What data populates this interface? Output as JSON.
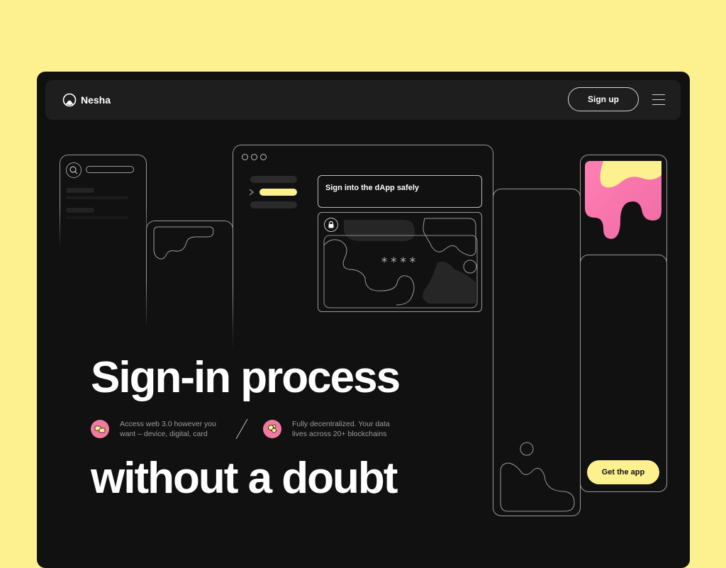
{
  "brand": {
    "name": "Nesha",
    "icon": "nesha-logo-icon"
  },
  "nav": {
    "signup_label": "Sign up",
    "menu_icon": "hamburger-menu-icon"
  },
  "illustration": {
    "card_title": "Sign into the dApp safely",
    "password_mask": "****",
    "lock_icon": "lock-icon",
    "arrow_icon": "chevron-right-icon"
  },
  "hero": {
    "headline_top": "Sign-in process",
    "headline_bottom": "without a doubt"
  },
  "features": [
    {
      "icon": "devices-icon",
      "text": "Access web 3.0 however you want – device, digital, card"
    },
    {
      "icon": "blockchain-icon",
      "text": "Fully decentralized. Your data lives across 20+ blockchains"
    }
  ],
  "cta": {
    "get_app_label": "Get the app"
  },
  "colors": {
    "page_bg": "#FDF08E",
    "window_bg": "#111111",
    "nav_bg": "#1E1E1E",
    "accent_yellow": "#FDF08E",
    "accent_pink": "#F07AA0"
  }
}
